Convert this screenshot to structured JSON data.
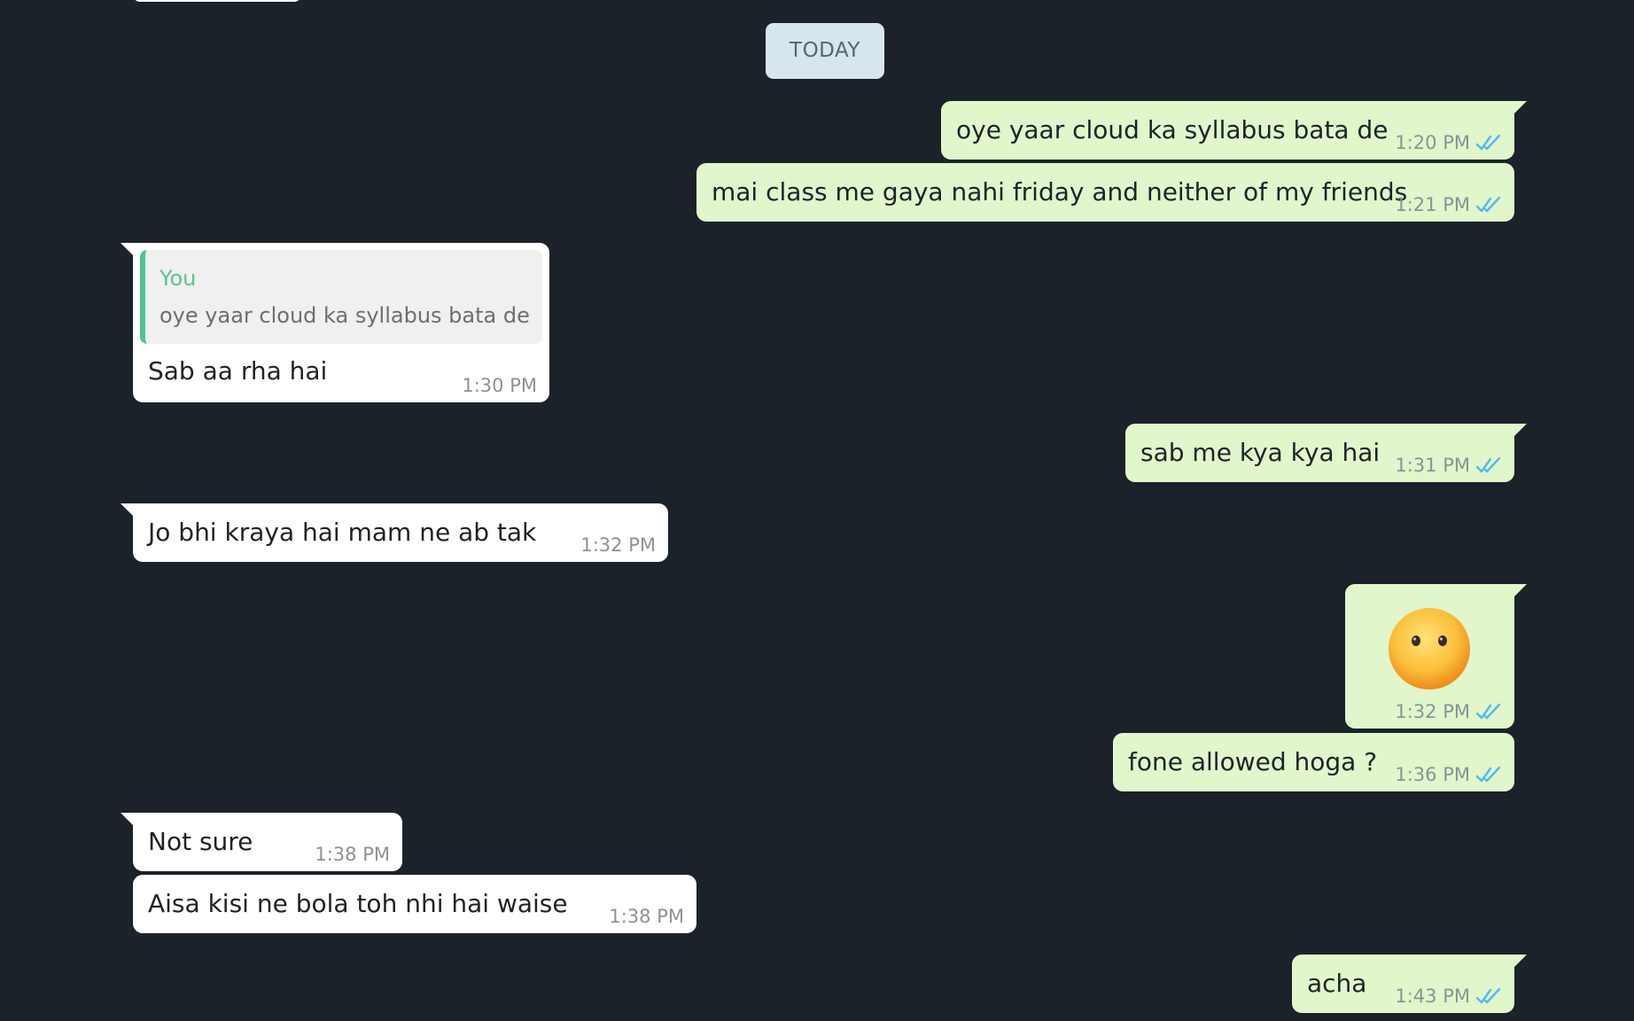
{
  "date_separator": "TODAY",
  "messages": [
    {
      "text": "oye yaar cloud ka syllabus bata de",
      "time": "1:20 PM"
    },
    {
      "text": "mai class me gaya nahi friday and neither of my friends",
      "time": "1:21 PM"
    },
    {
      "quote_author": "You",
      "quote_text": "oye yaar cloud ka syllabus bata de",
      "text": "Sab aa rha hai",
      "time": "1:30 PM"
    },
    {
      "text": "sab me kya kya hai",
      "time": "1:31 PM"
    },
    {
      "text": "Jo bhi kraya hai mam ne ab tak",
      "time": "1:32 PM"
    },
    {
      "emoji": "neutral-face-without-mouth",
      "time": "1:32 PM"
    },
    {
      "text": "fone allowed hoga ?",
      "time": "1:36 PM"
    },
    {
      "text": "Not sure",
      "time": "1:38 PM"
    },
    {
      "text": "Aisa kisi ne bola toh nhi hai waise",
      "time": "1:38 PM"
    },
    {
      "text": "acha",
      "time": "1:43 PM"
    }
  ],
  "colors": {
    "background": "#1b2229",
    "outgoing_bubble": "#e1f6cb",
    "incoming_bubble": "#ffffff",
    "date_pill": "#d6e5ee",
    "read_ticks": "#53b9ee",
    "quote_accent": "#4fc48e"
  }
}
